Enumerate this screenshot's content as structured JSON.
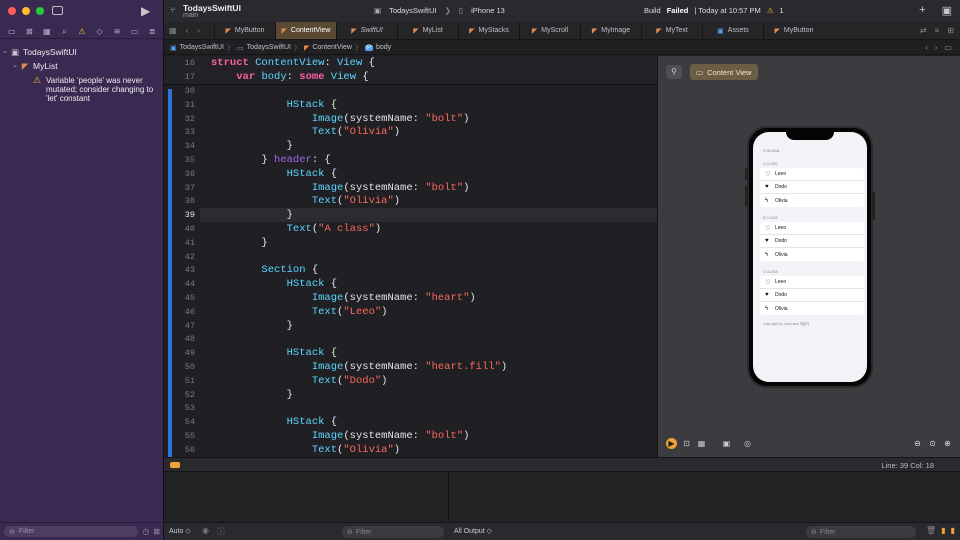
{
  "window": {
    "project": "TodaysSwiftUI",
    "branch": "main",
    "scheme_target": "TodaysSwiftUI",
    "device": "iPhone 13",
    "status_prefix": "Build",
    "status_failed": "Failed",
    "status_time": "| Today at 10:57 PM",
    "warning_count": "1"
  },
  "navigator": {
    "project_item": "TodaysSwiftUI",
    "file_item": "MyList",
    "issue_text": "Variable 'people' was never mutated; consider changing to 'let' constant",
    "filter_placeholder": "Filter"
  },
  "tabs": [
    {
      "label": "MyButton",
      "icon": "swift-file-icon"
    },
    {
      "label": "ContentView",
      "icon": "swift-file-icon",
      "active": true
    },
    {
      "label": "SwiftUI",
      "icon": "swift-file-icon",
      "italic": true
    },
    {
      "label": "MyList",
      "icon": "swift-file-icon"
    },
    {
      "label": "MyStacks",
      "icon": "swift-file-icon"
    },
    {
      "label": "MyScroll",
      "icon": "swift-file-icon"
    },
    {
      "label": "MyImage",
      "icon": "swift-file-icon"
    },
    {
      "label": "MyText",
      "icon": "swift-file-icon"
    },
    {
      "label": "Assets",
      "icon": "asset-catalog-icon"
    },
    {
      "label": "MyButton",
      "icon": "swift-file-icon"
    }
  ],
  "jumpbar": [
    "TodaysSwiftUI",
    "TodaysSwiftUI",
    "ContentView",
    "body"
  ],
  "editor": {
    "sticky": [
      {
        "n": "16",
        "html": "<span class=\"kw\">struct</span> <span class=\"ty\">ContentView</span>: <span class=\"ty\">View</span> {"
      },
      {
        "n": "17",
        "html": "    <span class=\"kw\">var</span> <span class=\"ty\">body</span>: <span class=\"kw\">some</span> <span class=\"ty\">View</span> {"
      }
    ],
    "lines": [
      {
        "n": "30",
        "html": ""
      },
      {
        "n": "31",
        "html": "            <span class=\"ty\">HStack</span> {"
      },
      {
        "n": "32",
        "html": "                <span class=\"ty\">Image</span>(systemName: <span class=\"st\">\"bolt\"</span>)"
      },
      {
        "n": "33",
        "html": "                <span class=\"ty\">Text</span>(<span class=\"st\">\"Olivia\"</span>)"
      },
      {
        "n": "34",
        "html": "            }"
      },
      {
        "n": "35",
        "html": "        } <span class=\"fn\">header</span>: {"
      },
      {
        "n": "36",
        "html": "            <span class=\"ty\">HStack</span> {"
      },
      {
        "n": "37",
        "html": "                <span class=\"ty\">Image</span>(systemName: <span class=\"st\">\"bolt\"</span>)"
      },
      {
        "n": "38",
        "html": "                <span class=\"ty\">Text</span>(<span class=\"st\">\"Olivia\"</span>)"
      },
      {
        "n": "39",
        "html": "            }",
        "current": true
      },
      {
        "n": "40",
        "html": "            <span class=\"ty\">Text</span>(<span class=\"st\">\"A class\"</span>)"
      },
      {
        "n": "41",
        "html": "        }"
      },
      {
        "n": "42",
        "html": ""
      },
      {
        "n": "43",
        "html": "        <span class=\"ty\">Section</span> {"
      },
      {
        "n": "44",
        "html": "            <span class=\"ty\">HStack</span> {"
      },
      {
        "n": "45",
        "html": "                <span class=\"ty\">Image</span>(systemName: <span class=\"st\">\"heart\"</span>)"
      },
      {
        "n": "46",
        "html": "                <span class=\"ty\">Text</span>(<span class=\"st\">\"Leeo\"</span>)"
      },
      {
        "n": "47",
        "html": "            }"
      },
      {
        "n": "48",
        "html": ""
      },
      {
        "n": "49",
        "html": "            <span class=\"ty\">HStack</span> {"
      },
      {
        "n": "50",
        "html": "                <span class=\"ty\">Image</span>(systemName: <span class=\"st\">\"heart.fill\"</span>)"
      },
      {
        "n": "51",
        "html": "                <span class=\"ty\">Text</span>(<span class=\"st\">\"Dodo\"</span>)"
      },
      {
        "n": "52",
        "html": "            }"
      },
      {
        "n": "53",
        "html": ""
      },
      {
        "n": "54",
        "html": "            <span class=\"ty\">HStack</span> {"
      },
      {
        "n": "55",
        "html": "                <span class=\"ty\">Image</span>(systemName: <span class=\"st\">\"bolt\"</span>)"
      },
      {
        "n": "56",
        "html": "                <span class=\"ty\">Text</span>(<span class=\"st\">\"Olivia\"</span>)"
      }
    ]
  },
  "canvas": {
    "preview_label": "Content View",
    "mini": {
      "top_label": "OLIVIA",
      "sections": [
        {
          "header": "A CLASS",
          "rows": [
            {
              "icon": "♡",
              "label": "Leeo"
            },
            {
              "icon": "♥",
              "label": "Dodo"
            },
            {
              "icon": "ϟ",
              "label": "Olivia"
            }
          ]
        },
        {
          "header": "B CLASS",
          "rows": [
            {
              "icon": "♡",
              "label": "Leeo"
            },
            {
              "icon": "♥",
              "label": "Dodo"
            },
            {
              "icon": "ϟ",
              "label": "Olivia"
            }
          ]
        },
        {
          "header": "C CLASS",
          "rows": [
            {
              "icon": "♡",
              "label": "Leeo"
            },
            {
              "icon": "♥",
              "label": "Dodo"
            },
            {
              "icon": "ϟ",
              "label": "Olivia"
            }
          ]
        }
      ],
      "footer": "copy right by Leeo and 개발자"
    }
  },
  "statusbar": {
    "line_col": "Line: 39  Col: 18"
  },
  "bottombar": {
    "auto": "Auto ◇",
    "filter_placeholder": "Filter",
    "output": "All Output ◇",
    "filter2_placeholder": "Filter"
  },
  "colors": {
    "accent": "#2d76d6",
    "warning": "#f3c12a",
    "build_failed": "#ffffff",
    "active_tab": "#5a4a33"
  }
}
